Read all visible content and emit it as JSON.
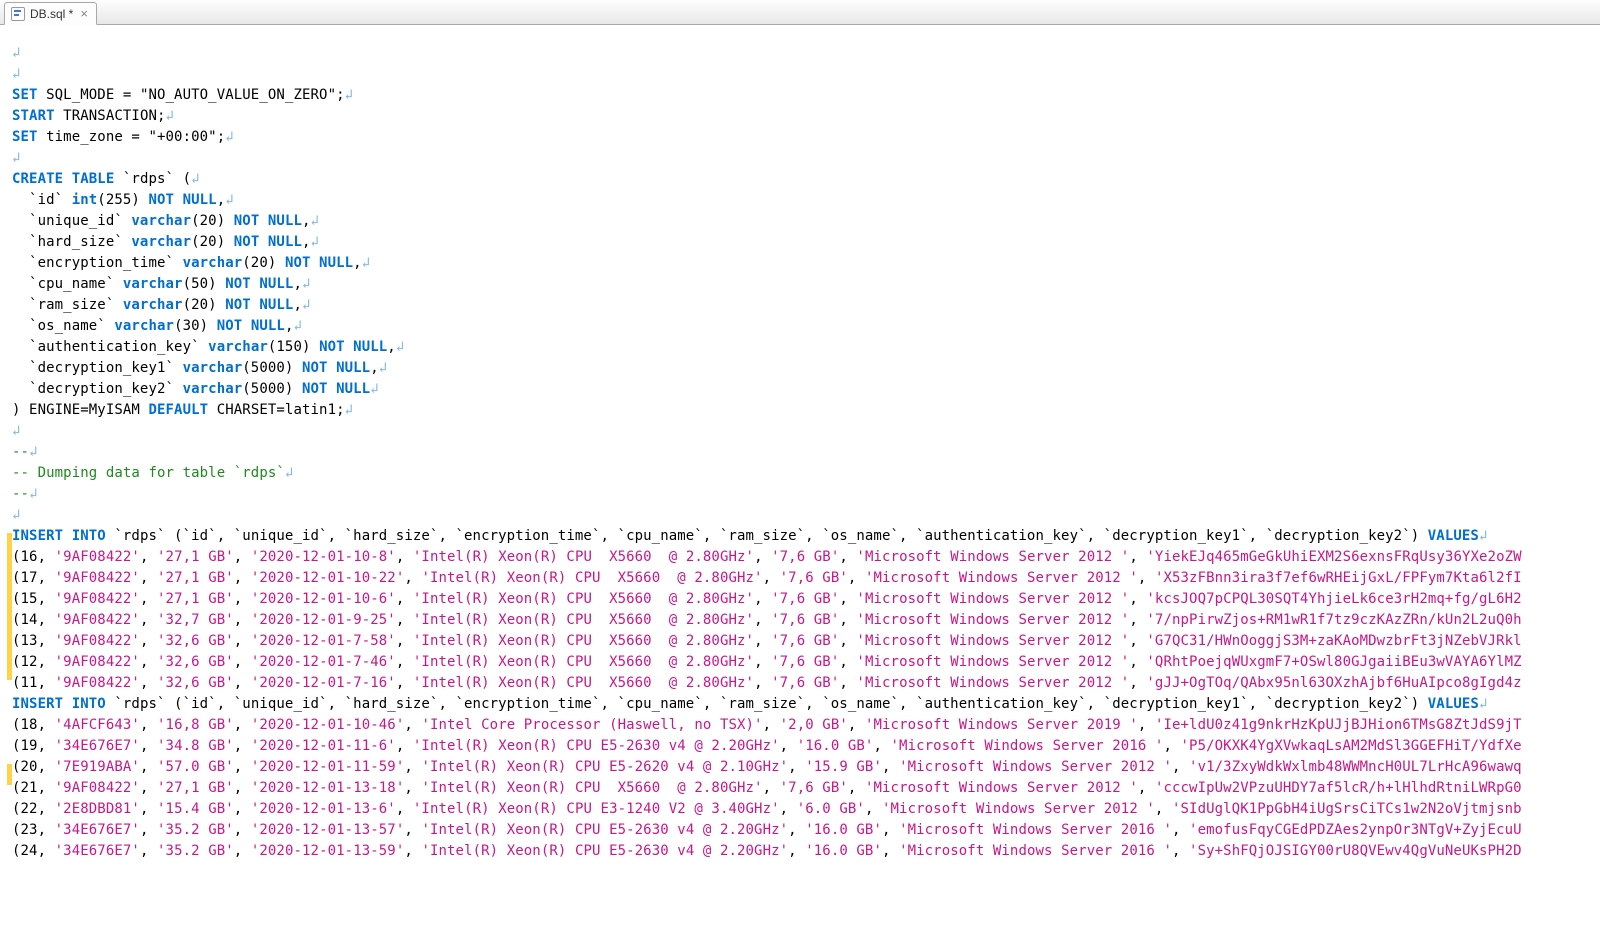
{
  "tab": {
    "title": "DB.sql *",
    "close_label": "×"
  },
  "eol": "↲",
  "code": {
    "set_mode_1": "SET",
    "set_mode_2": " SQL_MODE = \"NO_AUTO_VALUE_ON_ZERO\";",
    "start_1": "START",
    "start_2": " TRANSACTION;",
    "set_tz_1": "SET",
    "set_tz_2": " time_zone = \"+00:00\";",
    "create_table_kw": "CREATE TABLE",
    "create_table_name": " `rdps` (",
    "cols": [
      {
        "pre": "  `id` ",
        "type": "int",
        "args": "(255) ",
        "nn": "NOT NULL",
        "tail": ","
      },
      {
        "pre": "  `unique_id` ",
        "type": "varchar",
        "args": "(20) ",
        "nn": "NOT NULL",
        "tail": ","
      },
      {
        "pre": "  `hard_size` ",
        "type": "varchar",
        "args": "(20) ",
        "nn": "NOT NULL",
        "tail": ","
      },
      {
        "pre": "  `encryption_time` ",
        "type": "varchar",
        "args": "(20) ",
        "nn": "NOT NULL",
        "tail": ","
      },
      {
        "pre": "  `cpu_name` ",
        "type": "varchar",
        "args": "(50) ",
        "nn": "NOT NULL",
        "tail": ","
      },
      {
        "pre": "  `ram_size` ",
        "type": "varchar",
        "args": "(20) ",
        "nn": "NOT NULL",
        "tail": ","
      },
      {
        "pre": "  `os_name` ",
        "type": "varchar",
        "args": "(30) ",
        "nn": "NOT NULL",
        "tail": ","
      },
      {
        "pre": "  `authentication_key` ",
        "type": "varchar",
        "args": "(150) ",
        "nn": "NOT NULL",
        "tail": ","
      },
      {
        "pre": "  `decryption_key1` ",
        "type": "varchar",
        "args": "(5000) ",
        "nn": "NOT NULL",
        "tail": ","
      },
      {
        "pre": "  `decryption_key2` ",
        "type": "varchar",
        "args": "(5000) ",
        "nn": "NOT NULL",
        "tail": ""
      }
    ],
    "engine_1": ") ENGINE=MyISAM ",
    "engine_kw": "DEFAULT",
    "engine_2": " CHARSET=latin1;",
    "dash": "--",
    "dump_cmt": "-- Dumping data for table `rdps`",
    "insert_kw": "INSERT INTO",
    "insert_cols": " `rdps` (`id`, `unique_id`, `hard_size`, `encryption_time`, `cpu_name`, `ram_size`, `os_name`, `authentication_key`, `decryption_key1`, `decryption_key2`) ",
    "values_kw": "VALUES",
    "rows1": [
      {
        "n": "16",
        "u": "'9AF08422'",
        "h": "'27,1 GB'",
        "t": "'2020-12-01-10-8'",
        "cpu": "'Intel(R) Xeon(R) CPU  X5660  @ 2.80GHz'",
        "r": "'7,6 GB'",
        "os": "'Microsoft Windows Server 2012 '",
        "ak": "'YiekEJq465mGeGkUhiEXM2S6exnsFRqUsy36YXe2oZW"
      },
      {
        "n": "17",
        "u": "'9AF08422'",
        "h": "'27,1 GB'",
        "t": "'2020-12-01-10-22'",
        "cpu": "'Intel(R) Xeon(R) CPU  X5660  @ 2.80GHz'",
        "r": "'7,6 GB'",
        "os": "'Microsoft Windows Server 2012 '",
        "ak": "'X53zFBnn3ira3f7ef6wRHEijGxL/FPFym7Kta6l2fI"
      },
      {
        "n": "15",
        "u": "'9AF08422'",
        "h": "'27,1 GB'",
        "t": "'2020-12-01-10-6'",
        "cpu": "'Intel(R) Xeon(R) CPU  X5660  @ 2.80GHz'",
        "r": "'7,6 GB'",
        "os": "'Microsoft Windows Server 2012 '",
        "ak": "'kcsJOQ7pCPQL30SQT4YhjieLk6ce3rH2mq+fg/gL6H2"
      },
      {
        "n": "14",
        "u": "'9AF08422'",
        "h": "'32,7 GB'",
        "t": "'2020-12-01-9-25'",
        "cpu": "'Intel(R) Xeon(R) CPU  X5660  @ 2.80GHz'",
        "r": "'7,6 GB'",
        "os": "'Microsoft Windows Server 2012 '",
        "ak": "'7/npPirwZjos+RM1wR1f7tz9czKAzZRn/kUn2L2uQ0h"
      },
      {
        "n": "13",
        "u": "'9AF08422'",
        "h": "'32,6 GB'",
        "t": "'2020-12-01-7-58'",
        "cpu": "'Intel(R) Xeon(R) CPU  X5660  @ 2.80GHz'",
        "r": "'7,6 GB'",
        "os": "'Microsoft Windows Server 2012 '",
        "ak": "'G7QC31/HWnOoggjS3M+zaKAoMDwzbrFt3jNZebVJRkl"
      },
      {
        "n": "12",
        "u": "'9AF08422'",
        "h": "'32,6 GB'",
        "t": "'2020-12-01-7-46'",
        "cpu": "'Intel(R) Xeon(R) CPU  X5660  @ 2.80GHz'",
        "r": "'7,6 GB'",
        "os": "'Microsoft Windows Server 2012 '",
        "ak": "'QRhtPoejqWUxgmF7+OSwl80GJgaiiBEu3wVAYA6YlMZ"
      },
      {
        "n": "11",
        "u": "'9AF08422'",
        "h": "'32,6 GB'",
        "t": "'2020-12-01-7-16'",
        "cpu": "'Intel(R) Xeon(R) CPU  X5660  @ 2.80GHz'",
        "r": "'7,6 GB'",
        "os": "'Microsoft Windows Server 2012 '",
        "ak": "'gJJ+OgTOq/QAbx95nl63OXzhAjbf6HuAIpco8gIgd4z"
      }
    ],
    "rows2": [
      {
        "n": "18",
        "u": "'4AFCF643'",
        "h": "'16,8 GB'",
        "t": "'2020-12-01-10-46'",
        "cpu": "'Intel Core Processor (Haswell, no TSX)'",
        "r": "'2,0 GB'",
        "os": "'Microsoft Windows Server 2019 '",
        "ak": "'Ie+ldU0z41g9nkrHzKpUJjBJHion6TMsG8ZtJdS9jT"
      },
      {
        "n": "19",
        "u": "'34E676E7'",
        "h": "'34.8 GB'",
        "t": "'2020-12-01-11-6'",
        "cpu": "'Intel(R) Xeon(R) CPU E5-2630 v4 @ 2.20GHz'",
        "r": "'16.0 GB'",
        "os": "'Microsoft Windows Server 2016 '",
        "ak": "'P5/OKXK4YgXVwkaqLsAM2MdSl3GGEFHiT/YdfXe"
      },
      {
        "n": "20",
        "u": "'7E919ABA'",
        "h": "'57.0 GB'",
        "t": "'2020-12-01-11-59'",
        "cpu": "'Intel(R) Xeon(R) CPU E5-2620 v4 @ 2.10GHz'",
        "r": "'15.9 GB'",
        "os": "'Microsoft Windows Server 2012 '",
        "ak": "'v1/3ZxyWdkWxlmb48WWMncH0UL7LrHcA96wawq"
      },
      {
        "n": "21",
        "u": "'9AF08422'",
        "h": "'27,1 GB'",
        "t": "'2020-12-01-13-18'",
        "cpu": "'Intel(R) Xeon(R) CPU  X5660  @ 2.80GHz'",
        "r": "'7,6 GB'",
        "os": "'Microsoft Windows Server 2012 '",
        "ak": "'cccwIpUw2VPzuUHDY7af5lcR/h+lHlhdRtniLWRpG0"
      },
      {
        "n": "22",
        "u": "'2E8DBD81'",
        "h": "'15.4 GB'",
        "t": "'2020-12-01-13-6'",
        "cpu": "'Intel(R) Xeon(R) CPU E3-1240 V2 @ 3.40GHz'",
        "r": "'6.0 GB'",
        "os": "'Microsoft Windows Server 2012 '",
        "ak": "'SIdUglQK1PpGbH4iUgSrsCiTCs1w2N2oVjtmjsnb"
      },
      {
        "n": "23",
        "u": "'34E676E7'",
        "h": "'35.2 GB'",
        "t": "'2020-12-01-13-57'",
        "cpu": "'Intel(R) Xeon(R) CPU E5-2630 v4 @ 2.20GHz'",
        "r": "'16.0 GB'",
        "os": "'Microsoft Windows Server 2016 '",
        "ak": "'emofusFqyCGEdPDZAes2ynpOr3NTgV+ZyjEcuU"
      },
      {
        "n": "24",
        "u": "'34E676E7'",
        "h": "'35.2 GB'",
        "t": "'2020-12-01-13-59'",
        "cpu": "'Intel(R) Xeon(R) CPU E5-2630 v4 @ 2.20GHz'",
        "r": "'16.0 GB'",
        "os": "'Microsoft Windows Server 2016 '",
        "ak": "'Sy+ShFQjOJSIGY00rU8QVEwv4QgVuNeUKsPH2D"
      }
    ]
  }
}
